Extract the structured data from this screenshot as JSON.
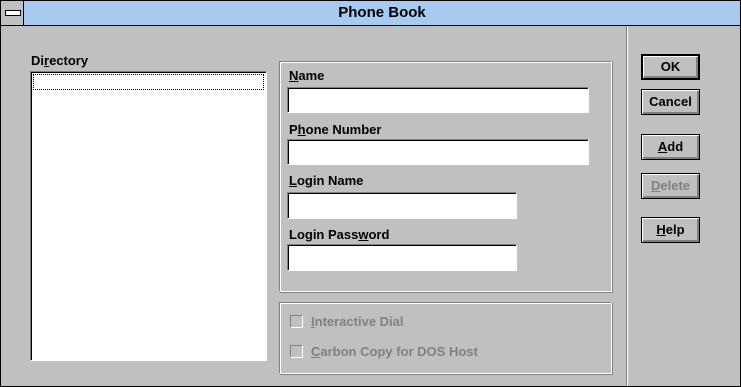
{
  "window": {
    "title": "Phone Book"
  },
  "directory": {
    "label_pre": "Di",
    "label_u": "r",
    "label_post": "ectory",
    "items": []
  },
  "fields": {
    "name": {
      "label_u": "N",
      "label_post": "ame",
      "value": ""
    },
    "phone": {
      "label_pre": "P",
      "label_u": "h",
      "label_post": "one Number",
      "value": ""
    },
    "login_name": {
      "label_u": "L",
      "label_post": "ogin Name",
      "value": ""
    },
    "login_password": {
      "label_pre": "Login Pass",
      "label_u": "w",
      "label_post": "ord",
      "value": ""
    }
  },
  "options": {
    "interactive_dial": {
      "label_u": "I",
      "label_post": "nteractive Dial",
      "checked": false,
      "enabled": false
    },
    "carbon_copy": {
      "label_u": "C",
      "label_post": "arbon Copy for DOS Host",
      "checked": false,
      "enabled": false
    }
  },
  "buttons": {
    "ok": "OK",
    "cancel": "Cancel",
    "add_u": "A",
    "add_post": "dd",
    "delete_u": "D",
    "delete_post": "elete",
    "help_u": "H",
    "help_post": "elp"
  },
  "colors": {
    "titlebar": "#a6caf0",
    "face": "#c0c0c0",
    "disabled_text": "#808080"
  },
  "icons": {
    "system_menu": "system-menu-icon",
    "checkbox": "checkbox-icon"
  }
}
